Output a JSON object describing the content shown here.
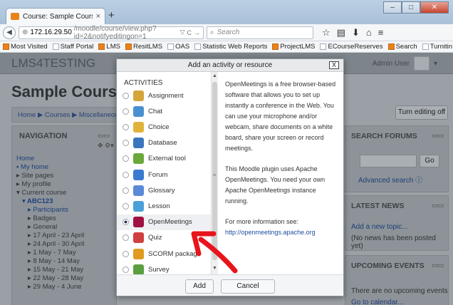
{
  "browser": {
    "tab_title": "Course: Sample Course",
    "tab_close": "×",
    "new_tab": "+",
    "url_host": "172.16.29.50",
    "url_path": "/moodle/course/view.php?id=2&notifyeditingon=1",
    "search_placeholder": "Search",
    "window_buttons": {
      "minimize": "–",
      "maximize": "□",
      "close": "✕"
    }
  },
  "bookmarks": [
    "Most Visited",
    "Staff Portal",
    "LMS",
    "ResitLMS",
    "OAS",
    "Statistic Web Reports",
    "ProjectLMS",
    "ECourseReserves",
    "Search",
    "Turnitin"
  ],
  "moodle": {
    "site_name": "LMS4TESTING",
    "user": "Admin User",
    "course_title": "Sample Course",
    "breadcrumb": "Home ▶ Courses ▶ Miscellaneous",
    "turn_editing": "Turn editing off"
  },
  "navigation": {
    "heading": "NAVIGATION",
    "items": [
      {
        "label": "Home",
        "style": "link"
      },
      {
        "label": "▪ My home",
        "style": "link"
      },
      {
        "label": "▸ Site pages",
        "style": "text"
      },
      {
        "label": "▸ My profile",
        "style": "text"
      },
      {
        "label": "▾ Current course",
        "style": "text"
      },
      {
        "label": "▾ ABC123",
        "style": "linkbold"
      },
      {
        "label": "▸ Participants",
        "style": "link"
      },
      {
        "label": "▸ Badges",
        "style": "text"
      },
      {
        "label": "▸ General",
        "style": "text"
      },
      {
        "label": "▸ 17 April - 23 April",
        "style": "text"
      },
      {
        "label": "▸ 24 April - 30 April",
        "style": "text"
      },
      {
        "label": "▸ 1 May - 7 May",
        "style": "text"
      },
      {
        "label": "▸ 8 May - 14 May",
        "style": "text"
      },
      {
        "label": "▸ 15 May - 21 May",
        "style": "text"
      },
      {
        "label": "▸ 22 May - 28 May",
        "style": "text"
      },
      {
        "label": "▸ 29 May - 4 June",
        "style": "text"
      }
    ]
  },
  "search_forums": {
    "heading": "SEARCH FORUMS",
    "go": "Go",
    "advanced": "Advanced search"
  },
  "latest_news": {
    "heading": "LATEST NEWS",
    "add_topic": "Add a new topic...",
    "none": "(No news has been posted yet)"
  },
  "upcoming_events": {
    "heading": "UPCOMING EVENTS",
    "none": "There are no upcoming events",
    "calendar": "Go to calendar..."
  },
  "dialog": {
    "title": "Add an activity or resource",
    "close": "X",
    "section_label": "ACTIVITIES",
    "activities": [
      {
        "label": "Assignment",
        "color": "#d4a53a"
      },
      {
        "label": "Chat",
        "color": "#4a90d0"
      },
      {
        "label": "Choice",
        "color": "#e0b33a"
      },
      {
        "label": "Database",
        "color": "#3a76c0"
      },
      {
        "label": "External tool",
        "color": "#6aa83a"
      },
      {
        "label": "Forum",
        "color": "#3a7ad0"
      },
      {
        "label": "Glossary",
        "color": "#5a8ad8"
      },
      {
        "label": "Lesson",
        "color": "#4aa0d8"
      },
      {
        "label": "OpenMeetings",
        "color": "#a01040",
        "selected": true
      },
      {
        "label": "Quiz",
        "color": "#d04040"
      },
      {
        "label": "SCORM package",
        "color": "#e09a20"
      },
      {
        "label": "Survey",
        "color": "#5aa040"
      }
    ],
    "description": [
      "OpenMeetings is a free browser-based software that allows you to set up instantly a conference in the Web. You can use your microphone and/or webcam, share documents on a white board, share your screen or record meetings.",
      "This Moodle plugin uses Apache OpenMeetings. You need your own Apache OpenMeetings instance running.",
      "For more information see:"
    ],
    "link": "http://openmeetings.apache.org",
    "add": "Add",
    "cancel": "Cancel"
  },
  "colors": {
    "annotation_arrow": "#e8141c",
    "dim_overlay": "#9aa0a5"
  }
}
